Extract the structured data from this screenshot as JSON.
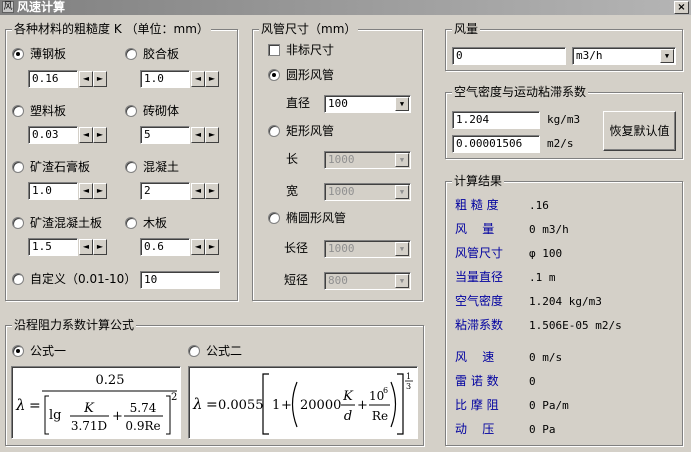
{
  "window": {
    "title": "风速计算",
    "close_label": "×",
    "icon_label": "风"
  },
  "roughness": {
    "legend": "各种材料的粗糙度 K （单位：mm）",
    "materials": [
      {
        "label": "薄钢板",
        "value": "0.16",
        "selected": true
      },
      {
        "label": "胶合板",
        "value": "1.0",
        "selected": false
      },
      {
        "label": "塑料板",
        "value": "0.03",
        "selected": false
      },
      {
        "label": "砖砌体",
        "value": "5",
        "selected": false
      },
      {
        "label": "矿渣石膏板",
        "value": "1.0",
        "selected": false
      },
      {
        "label": "混凝土",
        "value": "2",
        "selected": false
      },
      {
        "label": "矿渣混凝土板",
        "value": "1.5",
        "selected": false
      },
      {
        "label": "木板",
        "value": "0.6",
        "selected": false
      }
    ],
    "custom": {
      "label": "自定义（0.01-10）",
      "value": "10",
      "selected": false
    },
    "spin_left": "◄",
    "spin_right": "►"
  },
  "duct": {
    "legend": "风管尺寸（mm）",
    "nonstandard_label": "非标尺寸",
    "round": {
      "label": "圆形风管",
      "diameter_label": "直径",
      "diameter_value": "100"
    },
    "rect": {
      "label": "矩形风管",
      "length_label": "长",
      "length_value": "1000",
      "width_label": "宽",
      "width_value": "1000"
    },
    "oval": {
      "label": "椭圆形风管",
      "major_label": "长径",
      "major_value": "1000",
      "minor_label": "短径",
      "minor_value": "800"
    },
    "dropdown_arrow": "▼"
  },
  "flow": {
    "legend": "风量",
    "value": "0",
    "unit": "m3/h"
  },
  "air": {
    "legend": "空气密度与运动粘滞系数",
    "density_value": "1.204",
    "density_unit": "kg/m3",
    "viscosity_value": "0.00001506",
    "viscosity_unit": "m2/s",
    "reset_label": "恢复默认值"
  },
  "results": {
    "legend": "计算结果",
    "rows": [
      {
        "label": "粗 糙 度",
        "value": ".16"
      },
      {
        "label": "风    量",
        "value": "0 m3/h"
      },
      {
        "label": "风管尺寸",
        "value": "φ 100"
      },
      {
        "label": "当量直径",
        "value": ".1 m"
      },
      {
        "label": "空气密度",
        "value": "1.204 kg/m3"
      },
      {
        "label": "粘滞系数",
        "value": "1.506E-05 m2/s"
      },
      {
        "label": "风    速",
        "value": "0 m/s"
      },
      {
        "label": "雷 诺 数",
        "value": "0"
      },
      {
        "label": "比 摩 阻",
        "value": "0 Pa/m"
      },
      {
        "label": "动    压",
        "value": "0 Pa"
      }
    ]
  },
  "formula": {
    "legend": "沿程阻力系数计算公式",
    "option1_label": "公式一",
    "option2_label": "公式二",
    "f1": {
      "lambda": "λ",
      "eq": "=",
      "num": "0.25",
      "lg": "lg",
      "K": "K",
      "den1": "3.71D",
      "plus": "+",
      "num2": "5.74",
      "den2": "0.9Re",
      "pow": "2"
    },
    "f2": {
      "lambda": "λ",
      "eq": "=",
      "coef": "0.0055",
      "one": "1",
      "plus": "+",
      "c20000": "20000",
      "K": "K",
      "d": "d",
      "plus2": "+",
      "ten6": "10",
      "exp6": "6",
      "Re": "Re",
      "exp1": "1",
      "exp3": "3"
    }
  }
}
